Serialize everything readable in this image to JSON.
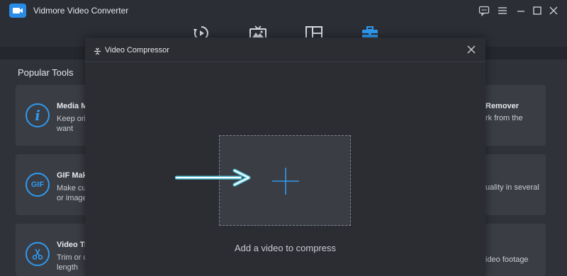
{
  "app": {
    "title": "Vidmore Video Converter",
    "accent_color": "#2f9af0"
  },
  "window_controls": [
    {
      "name": "feedback-icon"
    },
    {
      "name": "menu-icon"
    },
    {
      "name": "minimize-icon"
    },
    {
      "name": "maximize-icon"
    },
    {
      "name": "close-icon"
    }
  ],
  "nav": {
    "tabs": [
      {
        "name": "converter-tab",
        "icon": "refresh-play-icon"
      },
      {
        "name": "mv-tab",
        "icon": "image-tv-icon"
      },
      {
        "name": "collage-tab",
        "icon": "collage-icon"
      },
      {
        "name": "toolbox-tab",
        "icon": "toolbox-icon",
        "active": true
      }
    ]
  },
  "popular_tools": {
    "title": "Popular Tools",
    "cards": [
      {
        "name": "Media M",
        "desc": [
          "Keep origi",
          "want"
        ],
        "icon": "info-icon"
      },
      {
        "name": "GIF Make",
        "desc": [
          "Make cus",
          "or image"
        ],
        "icon": "gif-icon",
        "icon_text": "GIF"
      },
      {
        "name": "Video Tr",
        "desc": [
          "Trim or c",
          "length"
        ],
        "icon": "scissors-icon"
      }
    ],
    "right_fragments": [
      {
        "title": "Remover",
        "desc": "rk from the"
      },
      {
        "desc": "uality in several"
      },
      {
        "desc": "ideo footage"
      }
    ]
  },
  "dialog": {
    "title": "Video Compressor",
    "drop_caption": "Add a video to compress"
  }
}
